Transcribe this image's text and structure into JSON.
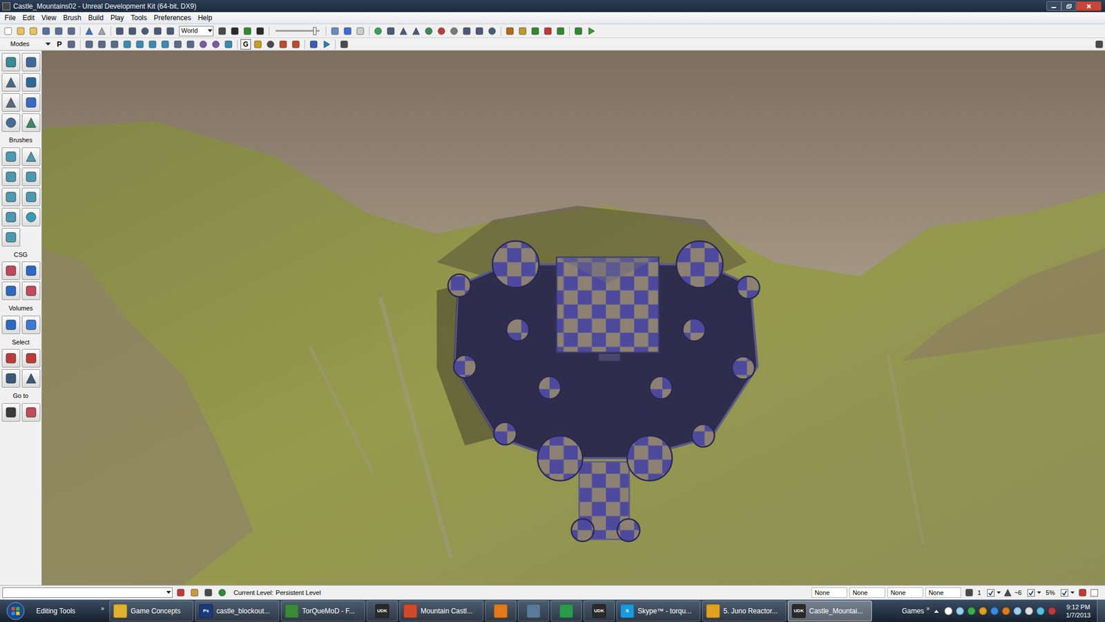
{
  "window": {
    "title": "Castle_Mountains02 - Unreal Development Kit (64-bit, DX9)"
  },
  "menu": [
    "File",
    "Edit",
    "View",
    "Brush",
    "Build",
    "Play",
    "Tools",
    "Preferences",
    "Help"
  ],
  "toolbar": {
    "coordinate_system": "World",
    "slider_level": 0.9
  },
  "modes_bar": {
    "label": "Modes",
    "p_button": "P",
    "g_button": "G"
  },
  "left_panel": {
    "sections": [
      "Brushes",
      "CSG",
      "Volumes",
      "Select",
      "Go to"
    ]
  },
  "status_bar": {
    "current_level_label": "Current Level:",
    "current_level": "Persistent Level",
    "slots": [
      "None",
      "None",
      "None",
      "None"
    ],
    "grid_size": "1",
    "rotation_snap": "~6",
    "scale_snap": "5%",
    "checks": [
      true,
      true,
      true
    ]
  },
  "taskbar": {
    "toolbar_label": "Editing Tools",
    "toolbar_chevron": "»",
    "games_label": "Games",
    "games_chevron": "»",
    "time": "9:12 PM",
    "date": "1/7/2013",
    "items": [
      {
        "kind": "labeled",
        "label": "Game Concepts",
        "icon_text": "",
        "selected": false
      },
      {
        "kind": "labeled",
        "label": "castle_blockout...",
        "icon_text": "Ps",
        "selected": false
      },
      {
        "kind": "labeled",
        "label": "TorQueMoD - F...",
        "icon_text": "",
        "selected": false
      },
      {
        "kind": "icon",
        "label": "",
        "icon_text": "UDK",
        "selected": false
      },
      {
        "kind": "labeled",
        "label": "Mountain Castl...",
        "icon_text": "",
        "selected": false
      },
      {
        "kind": "icon",
        "label": "",
        "icon_text": "",
        "selected": false
      },
      {
        "kind": "icon",
        "label": "",
        "icon_text": "",
        "selected": false
      },
      {
        "kind": "icon",
        "label": "",
        "icon_text": "",
        "selected": false
      },
      {
        "kind": "icon",
        "label": "",
        "icon_text": "UDK",
        "selected": false
      },
      {
        "kind": "labeled",
        "label": "Skype™ - torqu...",
        "icon_text": "S",
        "selected": false
      },
      {
        "kind": "labeled",
        "label": "5. Juno Reactor...",
        "icon_text": "",
        "selected": false
      },
      {
        "kind": "labeled",
        "label": "Castle_Mountai...",
        "icon_text": "UDK",
        "selected": true
      }
    ]
  }
}
